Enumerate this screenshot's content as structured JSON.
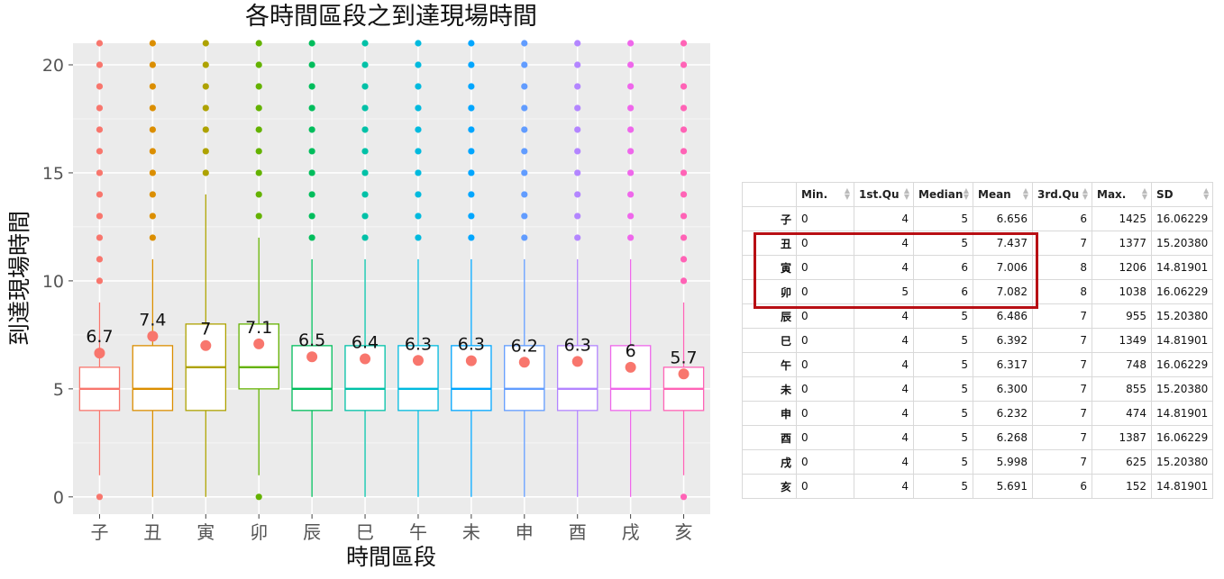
{
  "chart_data": {
    "type": "box",
    "title": "各時間區段之到達現場時間",
    "xlabel": "時間區段",
    "ylabel": "到達現場時間",
    "ylim": [
      -0.8,
      21
    ],
    "yticks": [
      0,
      5,
      10,
      15,
      20
    ],
    "grid": true,
    "categories": [
      "子",
      "丑",
      "寅",
      "卯",
      "辰",
      "巳",
      "午",
      "未",
      "申",
      "酉",
      "戌",
      "亥"
    ],
    "colors": [
      "#F8766D",
      "#DB8E00",
      "#AEA200",
      "#64B200",
      "#00BD5C",
      "#00C1A7",
      "#00BADE",
      "#00A6FF",
      "#619CFF",
      "#B385FF",
      "#EF67EB",
      "#FF63B6"
    ],
    "boxes": [
      {
        "q1": 4,
        "median": 5,
        "q3": 6,
        "whisker_low": 1,
        "whisker_high": 9,
        "mean": 6.656,
        "mean_label": "6.7",
        "outliers": [
          0,
          10,
          11,
          12,
          13,
          14,
          15,
          16,
          17,
          18,
          19,
          20,
          21
        ]
      },
      {
        "q1": 4,
        "median": 5,
        "q3": 7,
        "whisker_low": 0,
        "whisker_high": 11,
        "mean": 7.437,
        "mean_label": "7.4",
        "outliers": [
          12,
          13,
          14,
          15,
          16,
          17,
          18,
          19,
          20,
          21
        ]
      },
      {
        "q1": 4,
        "median": 6,
        "q3": 8,
        "whisker_low": 0,
        "whisker_high": 14,
        "mean": 7.006,
        "mean_label": "7",
        "outliers": [
          15,
          16,
          17,
          18,
          19,
          20,
          21
        ]
      },
      {
        "q1": 5,
        "median": 6,
        "q3": 8,
        "whisker_low": 1,
        "whisker_high": 12,
        "mean": 7.082,
        "mean_label": "7.1",
        "outliers": [
          0,
          13,
          14,
          15,
          16,
          17,
          18,
          19,
          20,
          21
        ]
      },
      {
        "q1": 4,
        "median": 5,
        "q3": 7,
        "whisker_low": 0,
        "whisker_high": 11,
        "mean": 6.486,
        "mean_label": "6.5",
        "outliers": [
          12,
          13,
          14,
          15,
          16,
          17,
          18,
          19,
          20,
          21
        ]
      },
      {
        "q1": 4,
        "median": 5,
        "q3": 7,
        "whisker_low": 0,
        "whisker_high": 11,
        "mean": 6.392,
        "mean_label": "6.4",
        "outliers": [
          12,
          13,
          14,
          15,
          16,
          17,
          18,
          19,
          20,
          21
        ]
      },
      {
        "q1": 4,
        "median": 5,
        "q3": 7,
        "whisker_low": 0,
        "whisker_high": 11,
        "mean": 6.317,
        "mean_label": "6.3",
        "outliers": [
          12,
          13,
          14,
          15,
          16,
          17,
          18,
          19,
          20,
          21
        ]
      },
      {
        "q1": 4,
        "median": 5,
        "q3": 7,
        "whisker_low": 0,
        "whisker_high": 11,
        "mean": 6.3,
        "mean_label": "6.3",
        "outliers": [
          12,
          13,
          14,
          15,
          16,
          17,
          18,
          19,
          20,
          21
        ]
      },
      {
        "q1": 4,
        "median": 5,
        "q3": 7,
        "whisker_low": 0,
        "whisker_high": 11,
        "mean": 6.232,
        "mean_label": "6.2",
        "outliers": [
          12,
          13,
          14,
          15,
          16,
          17,
          18,
          19,
          20,
          21
        ]
      },
      {
        "q1": 4,
        "median": 5,
        "q3": 7,
        "whisker_low": 0,
        "whisker_high": 11,
        "mean": 6.268,
        "mean_label": "6.3",
        "outliers": [
          12,
          13,
          14,
          15,
          16,
          17,
          18,
          19,
          20,
          21
        ]
      },
      {
        "q1": 4,
        "median": 5,
        "q3": 7,
        "whisker_low": 0,
        "whisker_high": 11,
        "mean": 5.998,
        "mean_label": "6",
        "outliers": [
          12,
          13,
          14,
          15,
          16,
          17,
          18,
          19,
          20,
          21
        ]
      },
      {
        "q1": 4,
        "median": 5,
        "q3": 6,
        "whisker_low": 1,
        "whisker_high": 9,
        "mean": 5.691,
        "mean_label": "5.7",
        "outliers": [
          0,
          10,
          11,
          12,
          13,
          14,
          15,
          16,
          17,
          18,
          19,
          20,
          21
        ]
      }
    ],
    "mean_marker_color": "#F8766D",
    "panel_background": "#EBEBEB"
  },
  "table": {
    "columns": [
      "",
      "Min.",
      "1st.Qu",
      "Median",
      "Mean",
      "3rd.Qu",
      "Max.",
      "SD"
    ],
    "rows": [
      [
        "子",
        "0",
        "4",
        "5",
        "6.656",
        "6",
        "1425",
        "16.06229"
      ],
      [
        "丑",
        "0",
        "4",
        "5",
        "7.437",
        "7",
        "1377",
        "15.20380"
      ],
      [
        "寅",
        "0",
        "4",
        "6",
        "7.006",
        "8",
        "1206",
        "14.81901"
      ],
      [
        "卯",
        "0",
        "5",
        "6",
        "7.082",
        "8",
        "1038",
        "16.06229"
      ],
      [
        "辰",
        "0",
        "4",
        "5",
        "6.486",
        "7",
        "955",
        "15.20380"
      ],
      [
        "巳",
        "0",
        "4",
        "5",
        "6.392",
        "7",
        "1349",
        "14.81901"
      ],
      [
        "午",
        "0",
        "4",
        "5",
        "6.317",
        "7",
        "748",
        "16.06229"
      ],
      [
        "未",
        "0",
        "4",
        "5",
        "6.300",
        "7",
        "855",
        "15.20380"
      ],
      [
        "申",
        "0",
        "4",
        "5",
        "6.232",
        "7",
        "474",
        "14.81901"
      ],
      [
        "酉",
        "0",
        "4",
        "5",
        "6.268",
        "7",
        "1387",
        "16.06229"
      ],
      [
        "戌",
        "0",
        "4",
        "5",
        "5.998",
        "7",
        "625",
        "15.20380"
      ],
      [
        "亥",
        "0",
        "4",
        "5",
        "5.691",
        "6",
        "152",
        "14.81901"
      ]
    ],
    "highlight_color": "#B80F14"
  }
}
